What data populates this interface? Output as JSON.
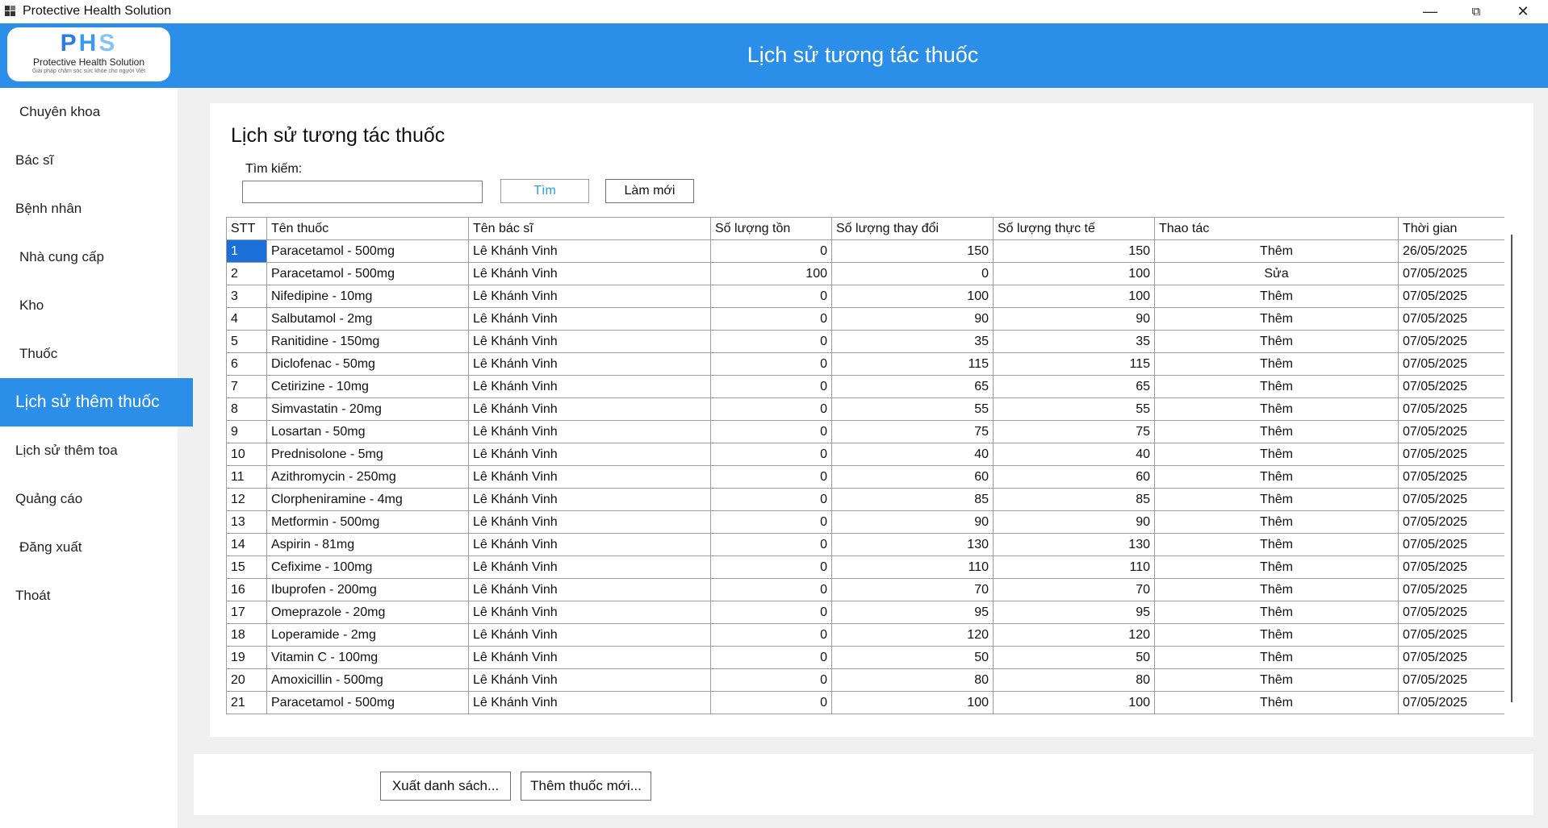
{
  "window": {
    "title": "Protective Health Solution"
  },
  "logo": {
    "letters": [
      "P",
      "H",
      "S"
    ],
    "name": "Protective Health Solution",
    "tagline": "Giải pháp chăm sóc sức khỏe cho người Việt"
  },
  "header": {
    "title": "Lịch sử tương tác thuốc"
  },
  "sidebar": {
    "items": [
      {
        "label": "Chuyên khoa"
      },
      {
        "label": "Bác sĩ"
      },
      {
        "label": "Bệnh nhân"
      },
      {
        "label": "Nhà cung cấp"
      },
      {
        "label": "Kho"
      },
      {
        "label": "Thuốc"
      },
      {
        "label": "Lịch sử thêm thuốc"
      },
      {
        "label": "Lịch sử thêm toa"
      },
      {
        "label": "Quảng cáo"
      },
      {
        "label": "Đăng xuất"
      },
      {
        "label": "Thoát"
      }
    ],
    "active_index": 6
  },
  "main": {
    "title": "Lịch sử tương tác thuốc",
    "search": {
      "label": "Tìm kiếm:",
      "value": "",
      "search_button": "Tìm",
      "refresh_button": "Làm mới"
    },
    "table": {
      "columns": [
        "STT",
        "Tên thuốc",
        "Tên bác sĩ",
        "Số lượng tồn",
        "Số lượng thay đổi",
        "Số lượng thực tế",
        "Thao tác",
        "Thời gian"
      ],
      "rows": [
        [
          "1",
          "Paracetamol - 500mg",
          "Lê Khánh Vinh",
          "0",
          "150",
          "150",
          "Thêm",
          "26/05/2025"
        ],
        [
          "2",
          "Paracetamol - 500mg",
          "Lê Khánh Vinh",
          "100",
          "0",
          "100",
          "Sửa",
          "07/05/2025"
        ],
        [
          "3",
          "Nifedipine - 10mg",
          "Lê Khánh Vinh",
          "0",
          "100",
          "100",
          "Thêm",
          "07/05/2025"
        ],
        [
          "4",
          "Salbutamol - 2mg",
          "Lê Khánh Vinh",
          "0",
          "90",
          "90",
          "Thêm",
          "07/05/2025"
        ],
        [
          "5",
          "Ranitidine - 150mg",
          "Lê Khánh Vinh",
          "0",
          "35",
          "35",
          "Thêm",
          "07/05/2025"
        ],
        [
          "6",
          "Diclofenac - 50mg",
          "Lê Khánh Vinh",
          "0",
          "115",
          "115",
          "Thêm",
          "07/05/2025"
        ],
        [
          "7",
          "Cetirizine - 10mg",
          "Lê Khánh Vinh",
          "0",
          "65",
          "65",
          "Thêm",
          "07/05/2025"
        ],
        [
          "8",
          "Simvastatin - 20mg",
          "Lê Khánh Vinh",
          "0",
          "55",
          "55",
          "Thêm",
          "07/05/2025"
        ],
        [
          "9",
          "Losartan - 50mg",
          "Lê Khánh Vinh",
          "0",
          "75",
          "75",
          "Thêm",
          "07/05/2025"
        ],
        [
          "10",
          "Prednisolone - 5mg",
          "Lê Khánh Vinh",
          "0",
          "40",
          "40",
          "Thêm",
          "07/05/2025"
        ],
        [
          "11",
          "Azithromycin - 250mg",
          "Lê Khánh Vinh",
          "0",
          "60",
          "60",
          "Thêm",
          "07/05/2025"
        ],
        [
          "12",
          "Clorpheniramine - 4mg",
          "Lê Khánh Vinh",
          "0",
          "85",
          "85",
          "Thêm",
          "07/05/2025"
        ],
        [
          "13",
          "Metformin - 500mg",
          "Lê Khánh Vinh",
          "0",
          "90",
          "90",
          "Thêm",
          "07/05/2025"
        ],
        [
          "14",
          "Aspirin - 81mg",
          "Lê Khánh Vinh",
          "0",
          "130",
          "130",
          "Thêm",
          "07/05/2025"
        ],
        [
          "15",
          "Cefixime - 100mg",
          "Lê Khánh Vinh",
          "0",
          "110",
          "110",
          "Thêm",
          "07/05/2025"
        ],
        [
          "16",
          "Ibuprofen - 200mg",
          "Lê Khánh Vinh",
          "0",
          "70",
          "70",
          "Thêm",
          "07/05/2025"
        ],
        [
          "17",
          "Omeprazole - 20mg",
          "Lê Khánh Vinh",
          "0",
          "95",
          "95",
          "Thêm",
          "07/05/2025"
        ],
        [
          "18",
          "Loperamide - 2mg",
          "Lê Khánh Vinh",
          "0",
          "120",
          "120",
          "Thêm",
          "07/05/2025"
        ],
        [
          "19",
          "Vitamin C - 100mg",
          "Lê Khánh Vinh",
          "0",
          "50",
          "50",
          "Thêm",
          "07/05/2025"
        ],
        [
          "20",
          "Amoxicillin - 500mg",
          "Lê Khánh Vinh",
          "0",
          "80",
          "80",
          "Thêm",
          "07/05/2025"
        ],
        [
          "21",
          "Paracetamol - 500mg",
          "Lê Khánh Vinh",
          "0",
          "100",
          "100",
          "Thêm",
          "07/05/2025"
        ]
      ]
    }
  },
  "footer": {
    "export_button": "Xuất danh sách...",
    "add_button": "Thêm thuốc mới..."
  },
  "colors": {
    "accent": "#2b8fea",
    "selected_cell": "#1b6fd6",
    "search_text": "#2b9fe0"
  }
}
